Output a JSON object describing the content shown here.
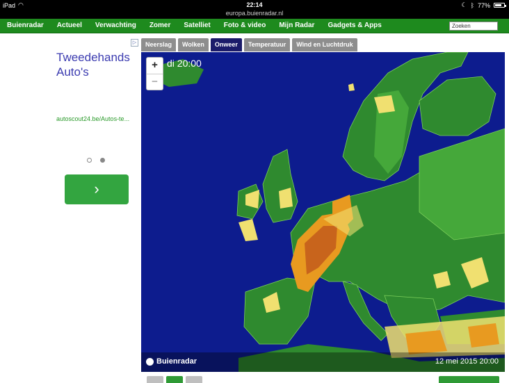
{
  "status_bar": {
    "device": "iPad",
    "time": "22:14",
    "battery": "77%",
    "battery_level": 0.77
  },
  "url": "europa.buienradar.nl",
  "nav": {
    "items": [
      "Buienradar",
      "Actueel",
      "Verwachting",
      "Zomer",
      "Satelliet",
      "Foto & video",
      "Mijn Radar",
      "Gadgets & Apps"
    ],
    "search_placeholder": "Zoeken"
  },
  "ad": {
    "badge": "▷",
    "title": "Tweedehands Auto's",
    "url": "autoscout24.be/Autos-te...",
    "button_icon": "chevron-right-icon",
    "button_glyph": "›"
  },
  "map_tabs": [
    "Neerslag",
    "Wolken",
    "Onweer",
    "Temperatuur",
    "Wind en Luchtdruk"
  ],
  "active_tab": "Onweer",
  "map": {
    "time_label": "di 20:00",
    "zoom_in": "+",
    "zoom_out": "−",
    "brand": "Buienradar",
    "timestamp": "12 mei 2015 20:00"
  },
  "colors": {
    "nav_green": "#1e8a1e",
    "sea": "#0d1c8e",
    "land": "#2f8a2f",
    "land_light": "#45a83a",
    "storm_low": "#f0e070",
    "storm_mid": "#e89a20",
    "storm_high": "#c8641c",
    "tab_active": "#1b1b6a"
  }
}
